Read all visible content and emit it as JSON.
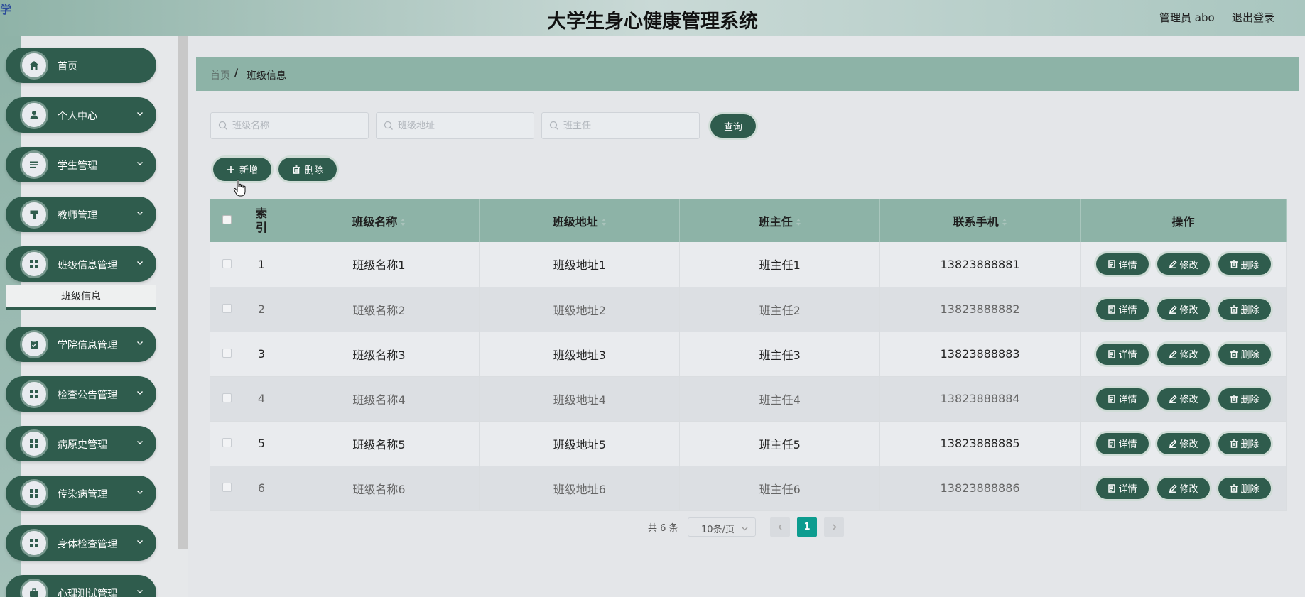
{
  "header": {
    "corner_glyph": "学",
    "title": "大学生身心健康管理系统",
    "user_label": "管理员 abo",
    "logout_label": "退出登录"
  },
  "sidebar": {
    "items": [
      {
        "label": "首页",
        "icon": "home-icon",
        "has_chevron": false
      },
      {
        "label": "个人中心",
        "icon": "user-icon",
        "has_chevron": true
      },
      {
        "label": "学生管理",
        "icon": "sliders-icon",
        "has_chevron": true
      },
      {
        "label": "教师管理",
        "icon": "podium-icon",
        "has_chevron": true
      },
      {
        "label": "班级信息管理",
        "icon": "grid-icon",
        "has_chevron": true
      },
      {
        "label": "学院信息管理",
        "icon": "clipboard-icon",
        "has_chevron": true
      },
      {
        "label": "检查公告管理",
        "icon": "grid-icon",
        "has_chevron": true
      },
      {
        "label": "病原史管理",
        "icon": "grid-icon",
        "has_chevron": true
      },
      {
        "label": "传染病管理",
        "icon": "grid-icon",
        "has_chevron": true
      },
      {
        "label": "身体检查管理",
        "icon": "grid-icon",
        "has_chevron": true
      },
      {
        "label": "心理测试管理",
        "icon": "briefcase-icon",
        "has_chevron": true
      }
    ],
    "submenu_label": "班级信息"
  },
  "breadcrumb": {
    "home": "首页",
    "separator": "/",
    "current": "班级信息"
  },
  "search": {
    "class_name_placeholder": "班级名称",
    "class_address_placeholder": "班级地址",
    "head_teacher_placeholder": "班主任",
    "query_label": "查询"
  },
  "toolbar": {
    "add_label": "新增",
    "delete_label": "删除"
  },
  "table": {
    "headers": {
      "index": "索引",
      "class_name": "班级名称",
      "class_address": "班级地址",
      "head_teacher": "班主任",
      "phone": "联系手机",
      "actions": "操作"
    },
    "rows": [
      {
        "index": "1",
        "class_name": "班级名称1",
        "class_address": "班级地址1",
        "head_teacher": "班主任1",
        "phone": "13823888881"
      },
      {
        "index": "2",
        "class_name": "班级名称2",
        "class_address": "班级地址2",
        "head_teacher": "班主任2",
        "phone": "13823888882"
      },
      {
        "index": "3",
        "class_name": "班级名称3",
        "class_address": "班级地址3",
        "head_teacher": "班主任3",
        "phone": "13823888883"
      },
      {
        "index": "4",
        "class_name": "班级名称4",
        "class_address": "班级地址4",
        "head_teacher": "班主任4",
        "phone": "13823888884"
      },
      {
        "index": "5",
        "class_name": "班级名称5",
        "class_address": "班级地址5",
        "head_teacher": "班主任5",
        "phone": "13823888885"
      },
      {
        "index": "6",
        "class_name": "班级名称6",
        "class_address": "班级地址6",
        "head_teacher": "班主任6",
        "phone": "13823888886"
      }
    ],
    "action_labels": {
      "detail": "详情",
      "edit": "修改",
      "delete": "删除"
    }
  },
  "pagination": {
    "total": "共 6 条",
    "page_size": "10条/页",
    "current_page": "1"
  },
  "colors": {
    "primary": "#2f5c4d",
    "header_teal": "#8db3a7",
    "active_page": "#0d9c8f"
  }
}
